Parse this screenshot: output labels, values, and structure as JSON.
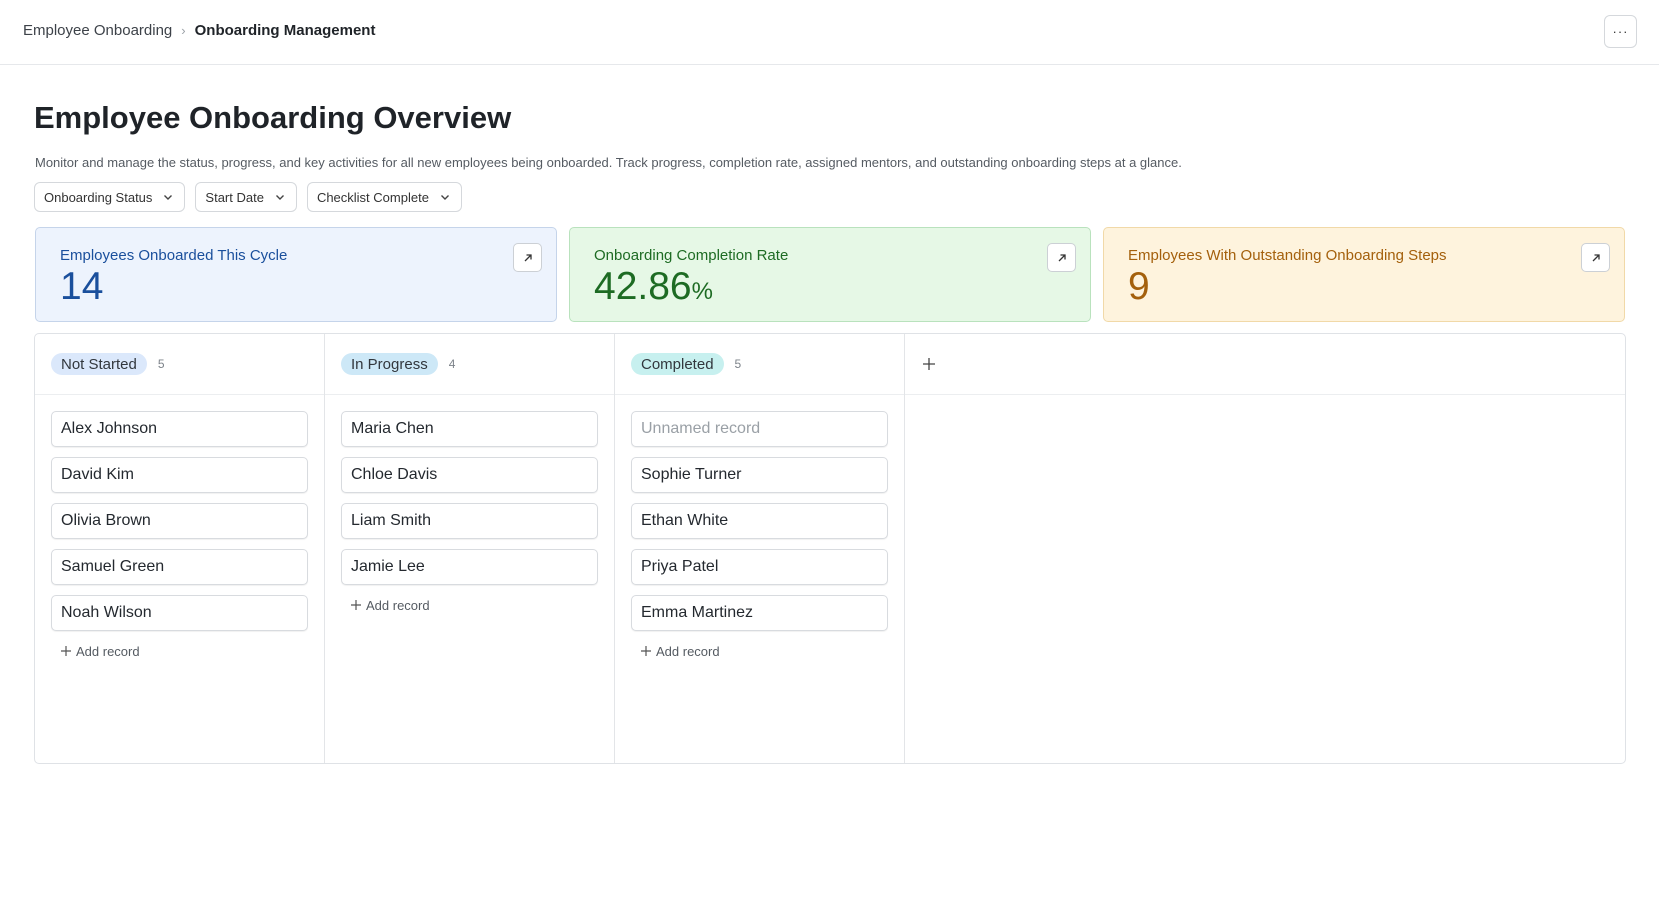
{
  "breadcrumb": {
    "parent": "Employee Onboarding",
    "separator": "›",
    "current": "Onboarding Management"
  },
  "header": {
    "more_label": "···"
  },
  "page": {
    "title": "Employee Onboarding Overview",
    "description": "Monitor and manage the status, progress, and key activities for all new employees being onboarded. Track progress, completion rate, assigned mentors, and outstanding onboarding steps at a glance."
  },
  "filters": [
    {
      "label": "Onboarding Status"
    },
    {
      "label": "Start Date"
    },
    {
      "label": "Checklist Complete"
    }
  ],
  "metrics": [
    {
      "label": "Employees Onboarded This Cycle",
      "value": "14",
      "unit": "",
      "color": "#1a4f9c"
    },
    {
      "label": "Onboarding Completion Rate",
      "value": "42.86",
      "unit": "%",
      "color": "#1d6b23"
    },
    {
      "label": "Employees With Outstanding Onboarding Steps",
      "value": "9",
      "unit": "",
      "color": "#a4600c"
    }
  ],
  "board": {
    "columns": [
      {
        "name": "Not Started",
        "count": "5",
        "records": [
          "Alex Johnson",
          "David Kim",
          "Olivia Brown",
          "Samuel Green",
          "Noah Wilson"
        ],
        "add_label": "Add record"
      },
      {
        "name": "In Progress",
        "count": "4",
        "records": [
          "Maria Chen",
          "Chloe Davis",
          "Liam Smith",
          "Jamie Lee"
        ],
        "add_label": "Add record"
      },
      {
        "name": "Completed",
        "count": "5",
        "records": [
          "Unnamed record",
          "Sophie Turner",
          "Ethan White",
          "Priya Patel",
          "Emma Martinez"
        ],
        "add_label": "Add record"
      }
    ]
  },
  "icons": {
    "chevron": "chevron-down-icon",
    "link": "arrow-up-right-icon",
    "plus": "plus-icon",
    "more": "more-horizontal-icon"
  }
}
